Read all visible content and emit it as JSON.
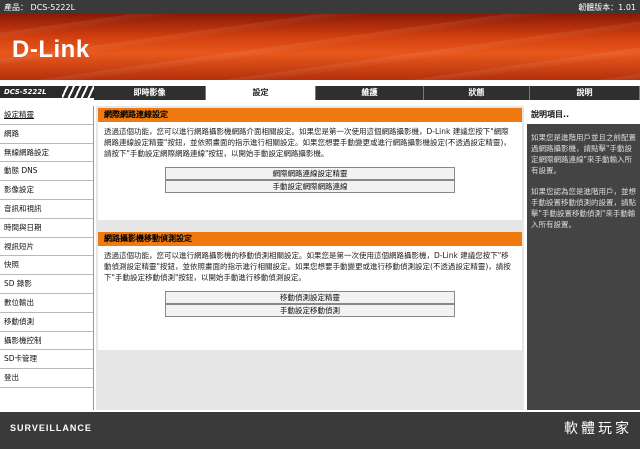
{
  "header": {
    "product_label": "產品： DCS-5222L",
    "firmware_label": "韌體版本：1.01"
  },
  "brand": {
    "logo": "D-Link",
    "model": "DCS-5222L"
  },
  "tabs": [
    {
      "label": "即時影像"
    },
    {
      "label": "設定"
    },
    {
      "label": "維護"
    },
    {
      "label": "狀態"
    },
    {
      "label": "說明"
    }
  ],
  "sidebar": {
    "items": [
      {
        "label": "設定精靈"
      },
      {
        "label": "網路"
      },
      {
        "label": "無線網路設定"
      },
      {
        "label": "動態 DNS"
      },
      {
        "label": "影像設定"
      },
      {
        "label": "音訊和視訊"
      },
      {
        "label": "時間與日期"
      },
      {
        "label": "視訊短片"
      },
      {
        "label": "快照"
      },
      {
        "label": "SD 錄影"
      },
      {
        "label": "數位輸出"
      },
      {
        "label": "移動偵測"
      },
      {
        "label": "攝影機控制"
      },
      {
        "label": "SD卡管理"
      },
      {
        "label": "登出"
      }
    ]
  },
  "sections": [
    {
      "title": "網際網路連線設定",
      "description": "透過這個功能，您可以進行網路攝影機網路介面相關設定。如果您是第一次使用這個網路攝影機，D-Link 建議您按下\"網際網路連線設定精靈\"按鈕，並依照畫面的指示進行相關設定。如果您想要手動變更或進行網路攝影機設定(不透過設定精靈)，請按下\"手動設定網際網路連線\"按鈕，以開始手動設定網路攝影機。",
      "buttons": [
        "網際網路連線設定精靈",
        "手動設定網際網路連線"
      ]
    },
    {
      "title": "網路攝影機移動偵測設定",
      "description": "透過這個功能，您可以進行網路攝影機的移動偵測相關設定。如果您是第一次使用這個網路攝影機，D-Link 建議您按下\"移動偵測設定精靈\"按鈕，並依照畫面的指示進行相關設定。如果您想要手動變更或進行移動偵測設定(不透過設定精靈)，請按下\"手動設定移動偵測\"按鈕，以開始手動進行移動偵測設定。",
      "buttons": [
        "移動偵測設定精靈",
        "手動設定移動偵測"
      ]
    }
  ],
  "help": {
    "title": "說明項目..",
    "paragraphs": [
      "如果您是進階用戶並且之前配置過網路攝影機，請點擊\"手動設定網際網路連線\"來手動輸入所有設置。",
      "如果您認為您是進階用戶，並想手動設置移動偵測的設置，請點擊\"手動設置移動偵測\"來手動輸入所有設置。"
    ]
  },
  "footer": {
    "brand": "SURVEILLANCE",
    "watermark": "軟體玩家"
  },
  "colors": {
    "accent": "#f07a10",
    "banner": "#d2400f",
    "dark": "#3a3a3a"
  }
}
